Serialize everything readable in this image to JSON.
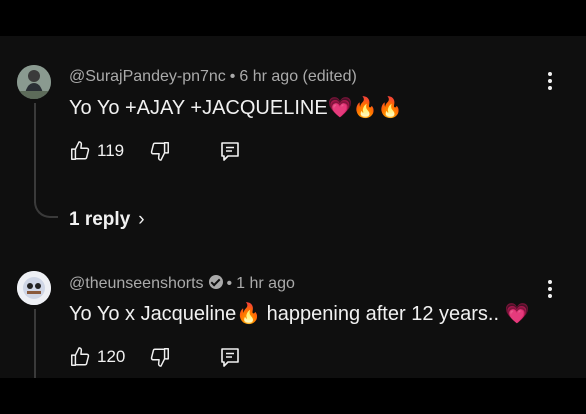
{
  "comments": [
    {
      "author": "@SurajPandey-pn7nc",
      "time": "6 hr ago (edited)",
      "text": "Yo Yo +AJAY +JACQUELINE💗🔥🔥",
      "likes": "119",
      "replies_label": "1 reply",
      "verified": false
    },
    {
      "author": "@theunseenshorts",
      "time": "1 hr ago",
      "text": "Yo Yo x Jacqueline🔥 happening after 12 years.. 💗",
      "likes": "120",
      "verified": true
    }
  ],
  "icons": {
    "like": "thumbs-up-icon",
    "dislike": "thumbs-down-icon",
    "reply": "comment-reply-icon",
    "more": "more-vert-icon"
  },
  "colors": {
    "background": "#0f0f0f",
    "meta_text": "#aaaaaa",
    "primary_text": "#f1f1f1"
  }
}
